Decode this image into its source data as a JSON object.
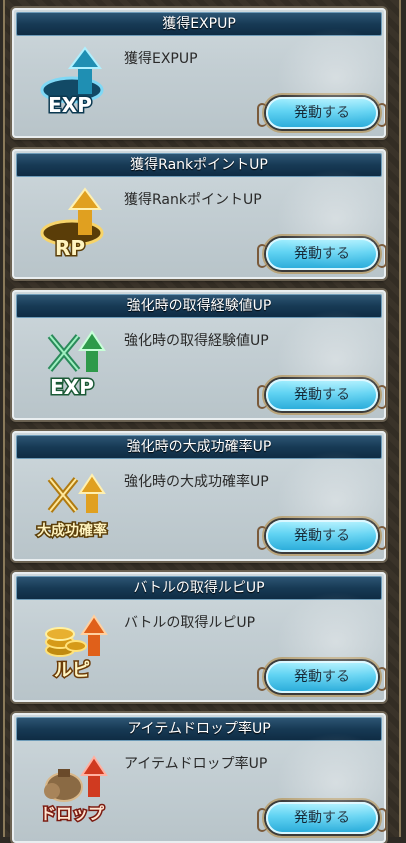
{
  "cards": [
    {
      "title": "獲得EXPUP",
      "description": "獲得EXPUP",
      "button": "発動する",
      "icon": "exp-up-icon",
      "icon_text": "EXP"
    },
    {
      "title": "獲得RankポイントUP",
      "description": "獲得RankポイントUP",
      "button": "発動する",
      "icon": "rank-point-up-icon",
      "icon_text": "RP"
    },
    {
      "title": "強化時の取得経験値UP",
      "description": "強化時の取得経験値UP",
      "button": "発動する",
      "icon": "enhance-exp-up-icon",
      "icon_text": "EXP"
    },
    {
      "title": "強化時の大成功確率UP",
      "description": "強化時の大成功確率UP",
      "button": "発動する",
      "icon": "great-success-rate-up-icon",
      "icon_text": "大成功確率"
    },
    {
      "title": "バトルの取得ルピUP",
      "description": "バトルの取得ルピUP",
      "button": "発動する",
      "icon": "rupie-up-icon",
      "icon_text": "ルピ"
    },
    {
      "title": "アイテムドロップ率UP",
      "description": "アイテムドロップ率UP",
      "button": "発動する",
      "icon": "item-drop-up-icon",
      "icon_text": "ドロップ"
    }
  ],
  "colors": {
    "title_bar": "#173a55",
    "button": "#5fd2f2",
    "up_arrow_teal": "#1f8fb3",
    "up_arrow_gold": "#e0a020",
    "up_arrow_green": "#2e9a4a",
    "up_arrow_red": "#d03a20"
  }
}
